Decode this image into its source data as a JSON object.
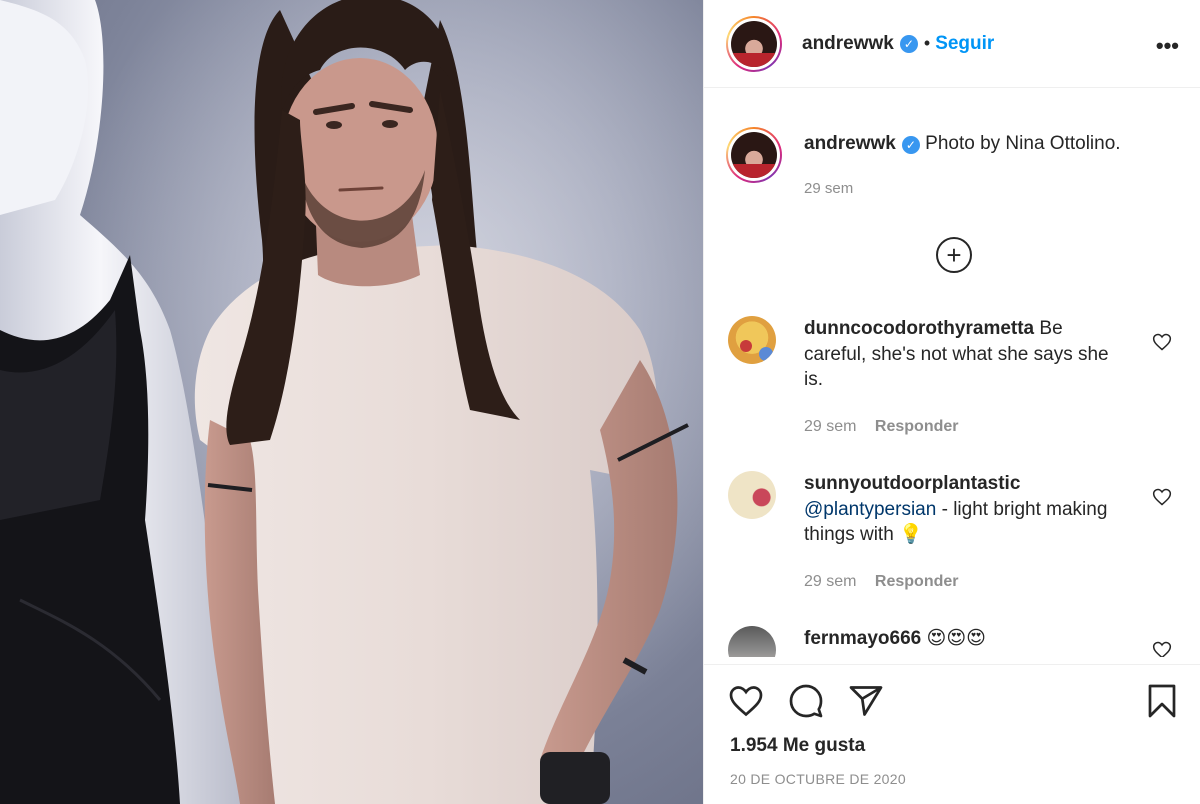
{
  "post": {
    "username": "andrewwk",
    "verified": true,
    "follow_label": "Seguir",
    "separator": "•",
    "more_icon": "more-horizontal-icon",
    "caption": {
      "text": "Photo by Nina Ottolino.",
      "time": "29 sem"
    },
    "load_more_icon": "plus-circle-icon",
    "comments": [
      {
        "username": "dunncocodorothyrametta",
        "text": "Be careful, she's not what she says she is.",
        "time": "29 sem",
        "reply_label": "Responder"
      },
      {
        "username": "sunnyoutdoorplantastic",
        "mention": "@plantypersian",
        "text": " - light bright making things with 💡",
        "time": "29 sem",
        "reply_label": "Responder"
      },
      {
        "username": "fernmayo666",
        "text": "😍😍😍"
      }
    ],
    "actions": {
      "icons": [
        "heart-icon",
        "comment-icon",
        "share-icon",
        "bookmark-icon"
      ]
    },
    "likes": "1.954 Me gusta",
    "date": "20 DE OCTUBRE DE 2020"
  },
  "colors": {
    "link_blue": "#0095f6",
    "verified_blue": "#3897f0",
    "muted": "#8e8e8e",
    "text": "#262626"
  }
}
